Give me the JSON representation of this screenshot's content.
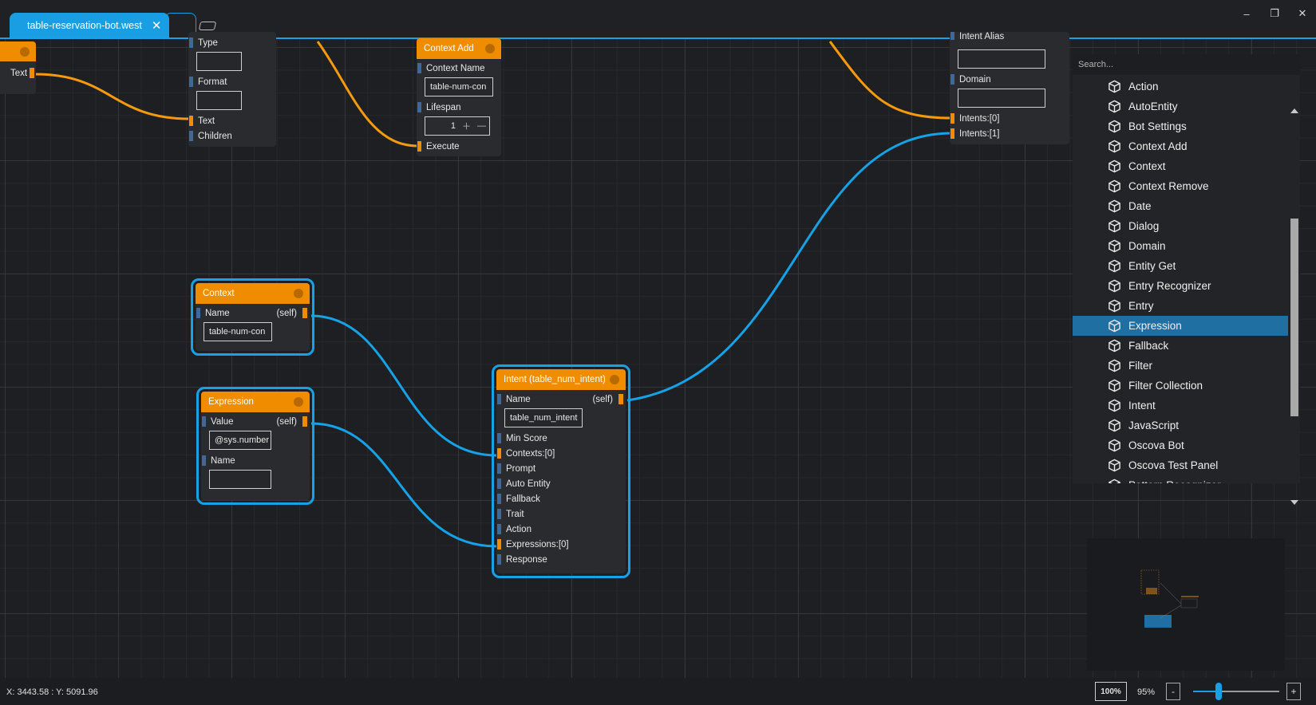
{
  "tab": {
    "title": "table-reservation-bot.west",
    "close": "✕"
  },
  "window": {
    "minimize": "–",
    "restore": "❐",
    "close": "✕"
  },
  "nodes": {
    "partial_left": {
      "text_label": "Text"
    },
    "partial_type": {
      "type_label": "Type",
      "format_label": "Format",
      "text_label": "Text",
      "children_label": "Children"
    },
    "context_add": {
      "title": "Context Add",
      "context_name_label": "Context Name",
      "context_name_value": "table-num-con",
      "lifespan_label": "Lifespan",
      "lifespan_value": "1",
      "execute_label": "Execute"
    },
    "partial_intent_alias": {
      "alias_label": "Intent Alias",
      "domain_label": "Domain",
      "intents0_label": "Intents:[0]",
      "intents1_label": "Intents:[1]"
    },
    "context": {
      "title": "Context",
      "name_label": "Name",
      "self_label": "(self)",
      "name_value": "table-num-con"
    },
    "expression": {
      "title": "Expression",
      "value_label": "Value",
      "self_label": "(self)",
      "value_value": "@sys.number",
      "name_label": "Name",
      "name_value": ""
    },
    "intent": {
      "title": "Intent (table_num_intent)",
      "name_label": "Name",
      "self_label": "(self)",
      "name_value": "table_num_intent",
      "rows": [
        "Min Score",
        "Contexts:[0]",
        "Prompt",
        "Auto Entity",
        "Fallback",
        "Trait",
        "Action",
        "Expressions:[0]",
        "Response"
      ]
    }
  },
  "search": {
    "placeholder": "Search...",
    "items": [
      "Action",
      "AutoEntity",
      "Bot Settings",
      "Context Add",
      "Context",
      "Context Remove",
      "Date",
      "Dialog",
      "Domain",
      "Entity Get",
      "Entry Recognizer",
      "Entry",
      "Expression",
      "Fallback",
      "Filter",
      "Filter Collection",
      "Intent",
      "JavaScript",
      "Oscova Bot",
      "Oscova Test Panel",
      "Pattern Recognizer"
    ],
    "selected_index": 12
  },
  "status": {
    "coords": "X: 3443.58 : Y: 5091.96",
    "zoom_reset": "100%",
    "zoom_level": "95%",
    "zoom_minus": "-",
    "zoom_plus": "+",
    "zoom_fraction": 0.3
  },
  "colors": {
    "accent": "#1aa0e6",
    "node_header": "#f08c00",
    "wire_orange": "#f59a0e",
    "wire_blue": "#15a3e8"
  }
}
